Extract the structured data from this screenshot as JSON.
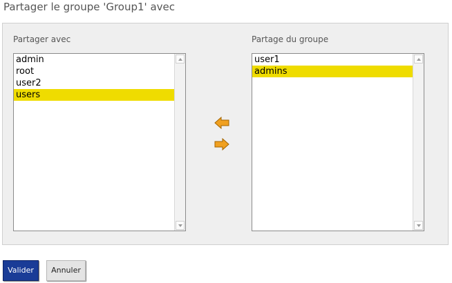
{
  "dialog": {
    "title": "Partager le groupe 'Group1' avec"
  },
  "left_list": {
    "label": "Partager avec",
    "items": [
      {
        "label": "admin",
        "selected": false
      },
      {
        "label": "root",
        "selected": false
      },
      {
        "label": "user2",
        "selected": false
      },
      {
        "label": "users",
        "selected": true
      }
    ]
  },
  "right_list": {
    "label": "Partage du groupe",
    "items": [
      {
        "label": "user1",
        "selected": false
      },
      {
        "label": "admins",
        "selected": true
      }
    ]
  },
  "transfer": {
    "add_icon": "arrow-left-icon",
    "remove_icon": "arrow-right-icon",
    "arrow_color": "#f0a020"
  },
  "buttons": {
    "validate": "Valider",
    "cancel": "Annuler"
  },
  "colors": {
    "selection": "#efdc00",
    "primary_button": "#1a3c97",
    "panel_background": "#efefef"
  }
}
